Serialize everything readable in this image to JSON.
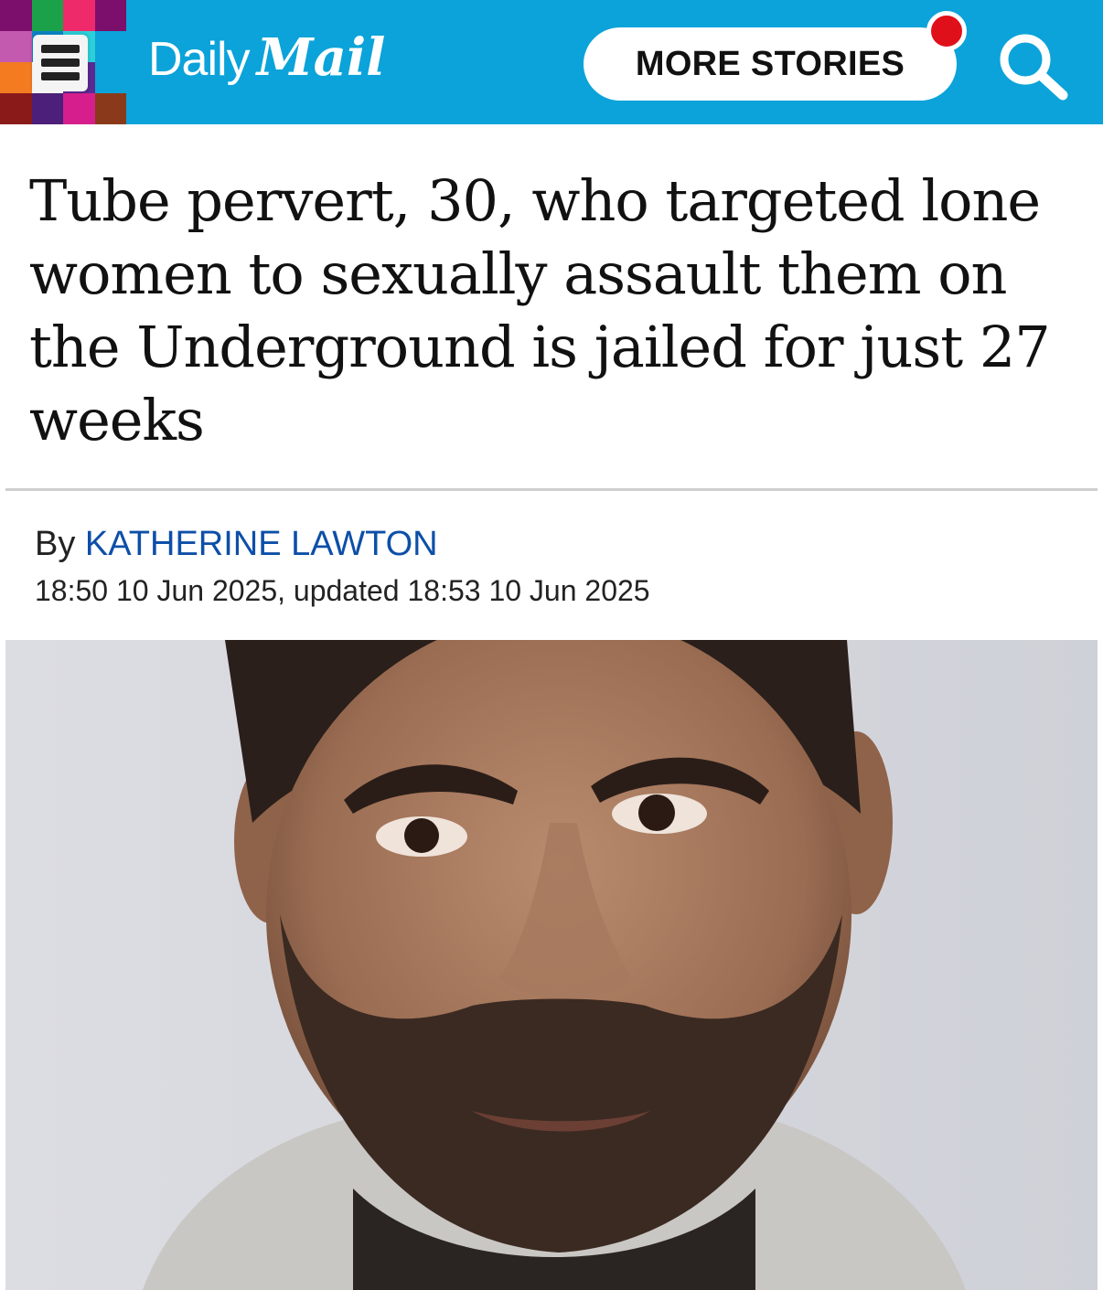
{
  "header": {
    "brand_primary": "Daily",
    "brand_secondary": "Mail",
    "more_stories_label": "MORE STORIES",
    "search_icon": "search-icon",
    "menu_icon": "hamburger-menu-icon",
    "bar_color": "#0ba3d9",
    "notification_color": "#e0101a",
    "mosaic_colors": [
      "#7b0f6b",
      "#1aa14a",
      "#ef2a6a",
      "#7b0f6b",
      "#c35ab0",
      "#0b84c6",
      "#2dd0d8",
      "#0ba3d9",
      "#f47b20",
      "#ffffff",
      "#5a2a91",
      "#0ba3d9",
      "#8a1a1a",
      "#4b1f7a",
      "#d61f8c",
      "#8a3a1a"
    ]
  },
  "article": {
    "headline": "Tube pervert, 30, who targeted lone women to sexually assault them on the Underground is jailed for just 27 weeks",
    "byline_prefix": "By",
    "author": "KATHERINE LAWTON",
    "author_color": "#0d4fa8",
    "timestamp": "18:50 10 Jun 2025, updated 18:53 10 Jun 2025"
  }
}
